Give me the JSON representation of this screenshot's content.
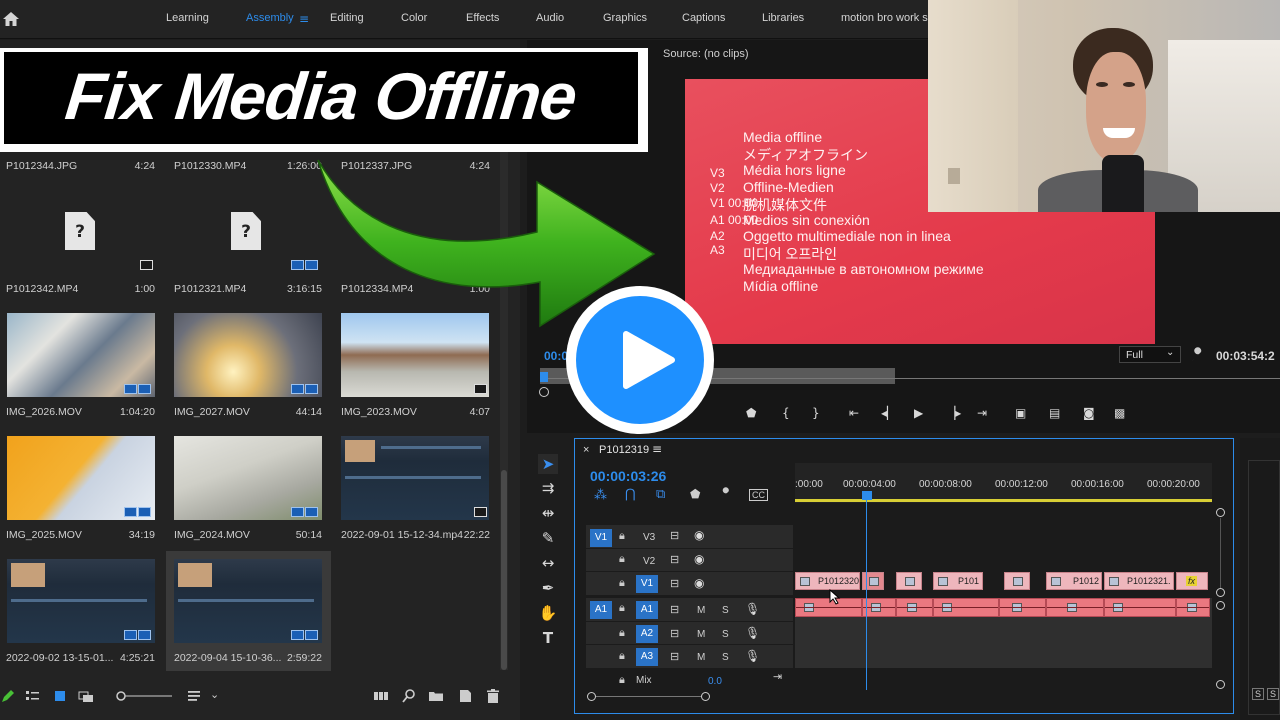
{
  "workspaces": [
    "Learning",
    "Assembly",
    "Editing",
    "Color",
    "Effects",
    "Audio",
    "Graphics",
    "Captions",
    "Libraries",
    "motion bro work sp"
  ],
  "active_workspace": "Assembly",
  "banner_title": "Fix Media Offline",
  "project": {
    "items": [
      {
        "name": "P1012344.JPG",
        "duration": "4:24"
      },
      {
        "name": "P1012330.MP4",
        "duration": "1:26:00"
      },
      {
        "name": "P1012337.JPG",
        "duration": "4:24"
      },
      {
        "name": "P1012342.MP4",
        "duration": "1:00"
      },
      {
        "name": "P1012321.MP4",
        "duration": "3:16:15"
      },
      {
        "name": "P1012334.MP4",
        "duration": "1:00"
      },
      {
        "name": "IMG_2026.MOV",
        "duration": "1:04:20"
      },
      {
        "name": "IMG_2027.MOV",
        "duration": "44:14"
      },
      {
        "name": "IMG_2023.MOV",
        "duration": "4:07"
      },
      {
        "name": "IMG_2025.MOV",
        "duration": "34:19"
      },
      {
        "name": "IMG_2024.MOV",
        "duration": "50:14"
      },
      {
        "name": "2022-09-01 15-12-34.mp4",
        "duration": "22:22"
      },
      {
        "name": "2022-09-02 13-15-01...",
        "duration": "4:25:21"
      },
      {
        "name": "2022-09-04 15-10-36...",
        "duration": "2:59:22"
      }
    ],
    "missing_glyph": "?"
  },
  "source": {
    "title": "Source: (no clips)",
    "offline_lines": [
      "Media offline",
      "メディアオフライン",
      "Média hors ligne",
      "Offline-Medien",
      "脱机媒体文件",
      "Medios sin conexión",
      "Oggetto multimediale non in linea",
      "미디어 오프라인",
      "Медиаданные в автономном режиме",
      "Mídia offline"
    ],
    "track_labels": [
      "V3",
      "V2",
      "V1 00:00",
      "A1 00:00",
      "A2",
      "A3"
    ],
    "timecode_left": "00:0",
    "zoom": "Full",
    "timecode_right": "00:03:54:2"
  },
  "timeline": {
    "sequence": "P1012319",
    "timecode": "00:00:03:26",
    "ruler": [
      ":00:00",
      "00:00:04:00",
      "00:00:08:00",
      "00:00:12:00",
      "00:00:16:00",
      "00:00:20:00"
    ],
    "video_tracks": [
      {
        "src": "V1",
        "name": "V3"
      },
      {
        "src": "",
        "name": "V2"
      },
      {
        "src": "",
        "name": "V1"
      }
    ],
    "audio_tracks": [
      {
        "src": "A1",
        "name": "A1",
        "m": "M",
        "s": "S"
      },
      {
        "src": "",
        "name": "A2",
        "m": "M",
        "s": "S"
      },
      {
        "src": "",
        "name": "A3",
        "m": "M",
        "s": "S"
      }
    ],
    "mix_label": "Mix",
    "mix_value": "0.0",
    "clips": [
      "P1012320",
      "P101",
      "P1012",
      "P1012321."
    ],
    "fx": "fx",
    "cc": "CC"
  },
  "right_panel": {
    "s1": "S",
    "s2": "S"
  },
  "colors": {
    "accent": "#2d8ceb",
    "offline_red": "#e43a4b",
    "clip_pink": "#eeb6bc",
    "audio_red": "#ea7880",
    "play_blue": "#1e90ff",
    "arrow_green": "#3fb21e"
  }
}
